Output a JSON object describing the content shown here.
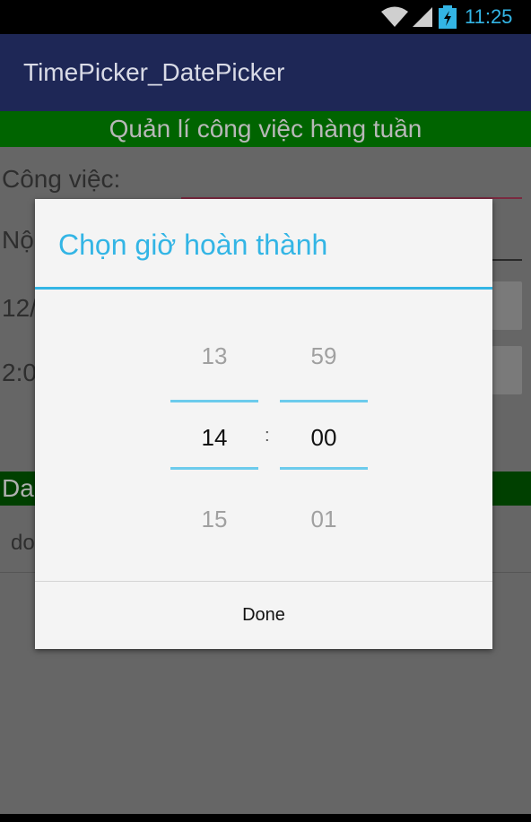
{
  "status_bar": {
    "time": "11:25",
    "wifi_icon": "wifi-icon",
    "signal_icon": "signal-icon",
    "battery_icon": "battery-charging-icon"
  },
  "app": {
    "title": "TimePicker_DatePicker"
  },
  "background": {
    "header": "Quản lí công việc hàng tuần",
    "task_label": "Công việc:",
    "content_label_partial": "Nộ",
    "date_partial": "12/",
    "time_partial": "2:0",
    "list_header_partial": "Da",
    "list_item_partial": "do"
  },
  "dialog": {
    "title": "Chọn giờ hoàn thành",
    "hour": {
      "prev": "13",
      "current": "14",
      "next": "15"
    },
    "separator": ":",
    "minute": {
      "prev": "59",
      "current": "00",
      "next": "01"
    },
    "done_label": "Done"
  },
  "colors": {
    "accent": "#33b5e5",
    "action_bar": "#1e2756",
    "header_green": "#006400"
  }
}
